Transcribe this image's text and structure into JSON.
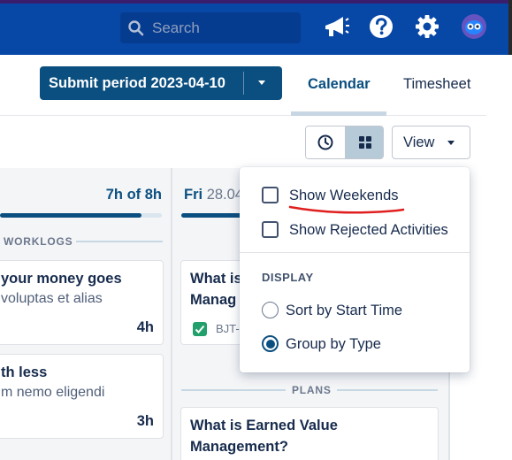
{
  "topbar": {
    "search_placeholder": "Search",
    "icons": [
      "megaphone-icon",
      "help-icon",
      "gear-icon",
      "avatar"
    ]
  },
  "header": {
    "submit_label": "Submit period 2023-04-10",
    "tabs": [
      {
        "label": "Calendar",
        "active": true
      },
      {
        "label": "Timesheet",
        "active": false
      }
    ],
    "view_label": "View",
    "toggle_icons": [
      "clock-icon",
      "grid-icon"
    ]
  },
  "left_column": {
    "total": "7h of 8h",
    "progress": 0.875,
    "section": "WORKLOGS",
    "cards": [
      {
        "title": "your money goes",
        "subtitle": "voluptas et alias",
        "hours": "4h"
      },
      {
        "title": "th less",
        "subtitle": "m nemo eligendi",
        "hours": "3h"
      }
    ]
  },
  "mid_column": {
    "day": "Fri",
    "date": "28.04",
    "progress": 0.4,
    "cards": [
      {
        "title_line1": "What is",
        "title_line2": "Manag",
        "issue_key": "BJT-"
      }
    ],
    "plans_section": "PLANS",
    "plan_cards": [
      {
        "title_line1": "What is Earned Value",
        "title_line2": "Management?"
      }
    ]
  },
  "dropdown": {
    "options": [
      {
        "label": "Show Weekends",
        "checked": false
      },
      {
        "label": "Show Rejected Activities",
        "checked": false
      }
    ],
    "section": "DISPLAY",
    "display_options": [
      {
        "label": "Sort by Start Time",
        "selected": false
      },
      {
        "label": "Group by Type",
        "selected": true
      }
    ]
  },
  "colors": {
    "topbar": "#0747a6",
    "primary": "#0b4f80",
    "annotation": "#e02020"
  }
}
